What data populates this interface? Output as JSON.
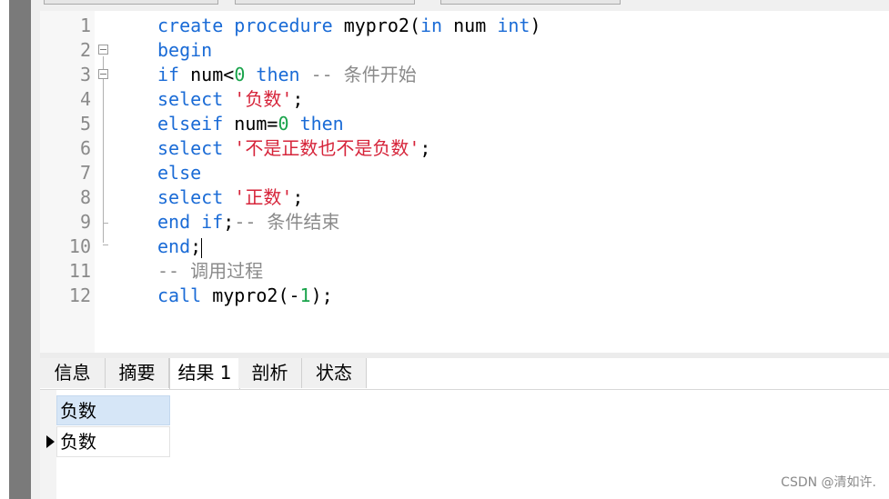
{
  "editor": {
    "line_numbers": [
      "1",
      "2",
      "3",
      "4",
      "5",
      "6",
      "7",
      "8",
      "9",
      "10",
      "11",
      "12"
    ],
    "lines": [
      [
        {
          "t": "create procedure ",
          "c": "kw"
        },
        {
          "t": "mypro2(",
          "c": ""
        },
        {
          "t": "in",
          "c": "kw"
        },
        {
          "t": " num ",
          "c": ""
        },
        {
          "t": "int",
          "c": "kw"
        },
        {
          "t": ")",
          "c": ""
        }
      ],
      [
        {
          "t": "begin",
          "c": "kw"
        }
      ],
      [
        {
          "t": "if",
          "c": "kw"
        },
        {
          "t": " num<",
          "c": ""
        },
        {
          "t": "0",
          "c": "num"
        },
        {
          "t": " ",
          "c": ""
        },
        {
          "t": "then",
          "c": "kw"
        },
        {
          "t": " -- 条件开始",
          "c": "cmt"
        }
      ],
      [
        {
          "t": "select",
          "c": "kw"
        },
        {
          "t": " ",
          "c": ""
        },
        {
          "t": "'负数'",
          "c": "str"
        },
        {
          "t": ";",
          "c": ""
        }
      ],
      [
        {
          "t": "elseif",
          "c": "kw"
        },
        {
          "t": " num=",
          "c": ""
        },
        {
          "t": "0",
          "c": "num"
        },
        {
          "t": " ",
          "c": ""
        },
        {
          "t": "then",
          "c": "kw"
        }
      ],
      [
        {
          "t": "select",
          "c": "kw"
        },
        {
          "t": " ",
          "c": ""
        },
        {
          "t": "'不是正数也不是负数'",
          "c": "str"
        },
        {
          "t": ";",
          "c": ""
        }
      ],
      [
        {
          "t": "else",
          "c": "kw"
        }
      ],
      [
        {
          "t": "select",
          "c": "kw"
        },
        {
          "t": " ",
          "c": ""
        },
        {
          "t": "'正数'",
          "c": "str"
        },
        {
          "t": ";",
          "c": ""
        }
      ],
      [
        {
          "t": "end",
          "c": "kw"
        },
        {
          "t": " ",
          "c": ""
        },
        {
          "t": "if",
          "c": "kw"
        },
        {
          "t": ";",
          "c": ""
        },
        {
          "t": "-- 条件结束",
          "c": "cmt"
        }
      ],
      [
        {
          "t": "end",
          "c": "kw"
        },
        {
          "t": ";",
          "c": ""
        }
      ],
      [
        {
          "t": "-- 调用过程",
          "c": "cmt"
        }
      ],
      [
        {
          "t": "call",
          "c": "kw"
        },
        {
          "t": " mypro2(-",
          "c": ""
        },
        {
          "t": "1",
          "c": "num"
        },
        {
          "t": ");",
          "c": ""
        }
      ]
    ]
  },
  "tabs": [
    {
      "label": "信息",
      "active": false
    },
    {
      "label": "摘要",
      "active": false
    },
    {
      "label": "结果 1",
      "active": true
    },
    {
      "label": "剖析",
      "active": false
    },
    {
      "label": "状态",
      "active": false
    }
  ],
  "result": {
    "column_header": "负数",
    "rows": [
      [
        "负数"
      ]
    ]
  },
  "watermark": "CSDN @清如许.",
  "colors": {
    "keyword": "#1a6bd6",
    "number": "#18a34a",
    "string": "#d6243a",
    "comment": "#8a8a8a",
    "header_bg": "#d6e6f7"
  }
}
